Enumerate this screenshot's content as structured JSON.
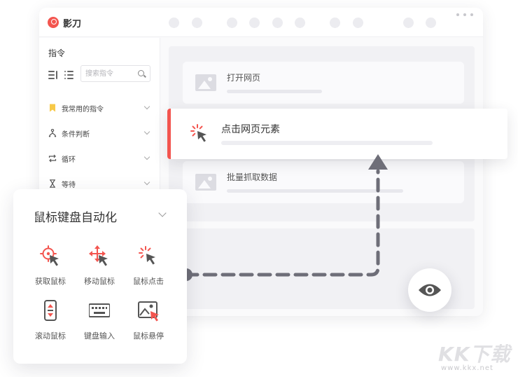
{
  "app": {
    "name": "影刀"
  },
  "sidebar": {
    "title": "指令",
    "search_placeholder": "搜索指令",
    "items": [
      {
        "label": "我常用的指令",
        "icon": "bookmark-icon"
      },
      {
        "label": "条件判断",
        "icon": "branch-icon"
      },
      {
        "label": "循环",
        "icon": "loop-icon"
      },
      {
        "label": "等待",
        "icon": "hourglass-icon"
      }
    ]
  },
  "flow": {
    "steps": [
      {
        "label": "打开网页",
        "icon": "image-icon"
      },
      {
        "label": "点击网页元素",
        "icon": "click-cursor-icon",
        "active": true
      },
      {
        "label": "批量抓取数据",
        "icon": "image-icon"
      }
    ]
  },
  "panel": {
    "title": "鼠标键盘自动化",
    "tools": [
      {
        "label": "获取鼠标",
        "icon": "crosshair-cursor-icon"
      },
      {
        "label": "移动鼠标",
        "icon": "move-cursor-icon"
      },
      {
        "label": "鼠标点击",
        "icon": "click-cursor-icon"
      },
      {
        "label": "滚动鼠标",
        "icon": "scroll-mouse-icon"
      },
      {
        "label": "键盘输入",
        "icon": "keyboard-icon"
      },
      {
        "label": "鼠标悬停",
        "icon": "hover-image-icon"
      }
    ]
  },
  "colors": {
    "accent": "#f3554f",
    "connector": "#6e6e78"
  },
  "watermark": {
    "text": "KK下载",
    "url": "www.kkx.net"
  }
}
